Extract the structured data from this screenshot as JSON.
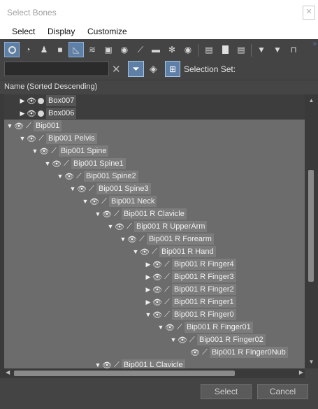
{
  "window": {
    "title": "Select Bones",
    "close_glyph": "✕"
  },
  "menu": [
    "Select",
    "Display",
    "Customize"
  ],
  "toolbar": {
    "icons": [
      "circle-filter-icon",
      "shapes-filter-icon",
      "light-filter-icon",
      "camera-filter-icon",
      "helper-filter-icon",
      "spacewarp-filter-icon",
      "group-filter-icon",
      "xref-filter-icon",
      "bone-filter-icon",
      "container-filter-icon",
      "frozen-filter-icon",
      "hidden-filter-icon",
      "list-icon",
      "document-icon",
      "document-lines-icon",
      "filter-display-icon",
      "funnel-icon",
      "folder-icon"
    ],
    "search_value": "",
    "selection_set_label": "Selection Set:"
  },
  "column_header": "Name (Sorted Descending)",
  "tree": [
    {
      "label": "Box007",
      "depth": 1,
      "expand": "collapsed",
      "type": "box",
      "selected": false
    },
    {
      "label": "Box006",
      "depth": 1,
      "expand": "collapsed",
      "type": "box",
      "selected": false
    },
    {
      "label": "Bip001",
      "depth": 0,
      "expand": "expanded",
      "type": "bone",
      "selected": true
    },
    {
      "label": "Bip001 Pelvis",
      "depth": 1,
      "expand": "expanded",
      "type": "bone",
      "selected": true
    },
    {
      "label": "Bip001 Spine",
      "depth": 2,
      "expand": "expanded",
      "type": "bone",
      "selected": true
    },
    {
      "label": "Bip001 Spine1",
      "depth": 3,
      "expand": "expanded",
      "type": "bone",
      "selected": true
    },
    {
      "label": "Bip001 Spine2",
      "depth": 4,
      "expand": "expanded",
      "type": "bone",
      "selected": true
    },
    {
      "label": "Bip001 Spine3",
      "depth": 5,
      "expand": "expanded",
      "type": "bone",
      "selected": true
    },
    {
      "label": "Bip001 Neck",
      "depth": 6,
      "expand": "expanded",
      "type": "bone",
      "selected": true
    },
    {
      "label": "Bip001 R Clavicle",
      "depth": 7,
      "expand": "expanded",
      "type": "bone",
      "selected": true
    },
    {
      "label": "Bip001 R UpperArm",
      "depth": 8,
      "expand": "expanded",
      "type": "bone",
      "selected": true
    },
    {
      "label": "Bip001 R Forearm",
      "depth": 9,
      "expand": "expanded",
      "type": "bone",
      "selected": true
    },
    {
      "label": "Bip001 R Hand",
      "depth": 10,
      "expand": "expanded",
      "type": "bone",
      "selected": true
    },
    {
      "label": "Bip001 R Finger4",
      "depth": 11,
      "expand": "collapsed",
      "type": "bone",
      "selected": true
    },
    {
      "label": "Bip001 R Finger3",
      "depth": 11,
      "expand": "collapsed",
      "type": "bone",
      "selected": true
    },
    {
      "label": "Bip001 R Finger2",
      "depth": 11,
      "expand": "collapsed",
      "type": "bone",
      "selected": true
    },
    {
      "label": "Bip001 R Finger1",
      "depth": 11,
      "expand": "collapsed",
      "type": "bone",
      "selected": true
    },
    {
      "label": "Bip001 R Finger0",
      "depth": 11,
      "expand": "expanded",
      "type": "bone",
      "selected": true
    },
    {
      "label": "Bip001 R Finger01",
      "depth": 12,
      "expand": "expanded",
      "type": "bone",
      "selected": true
    },
    {
      "label": "Bip001 R Finger02",
      "depth": 13,
      "expand": "expanded",
      "type": "bone",
      "selected": true
    },
    {
      "label": "Bip001 R Finger0Nub",
      "depth": 14,
      "expand": "none",
      "type": "bone",
      "selected": true
    },
    {
      "label": "Bip001 L Clavicle",
      "depth": 7,
      "expand": "expanded",
      "type": "bone",
      "selected": true
    }
  ],
  "buttons": {
    "select": "Select",
    "cancel": "Cancel"
  },
  "colors": {
    "accent": "#5e7fa6",
    "selected_row": "#6c6c6c",
    "background": "#444444"
  }
}
